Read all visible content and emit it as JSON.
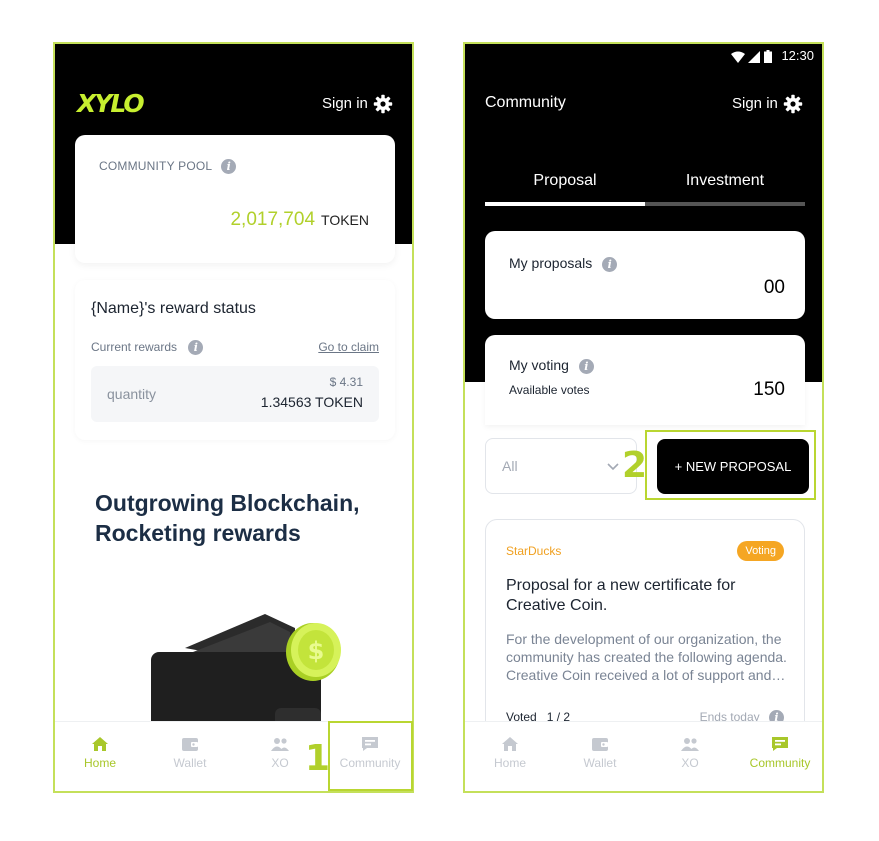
{
  "left": {
    "logo": "XYLO",
    "sign_in": "Sign in",
    "pool": {
      "label": "COMMUNITY POOL",
      "value": "2,017,704",
      "unit": "TOKEN"
    },
    "reward": {
      "title": "{Name}'s reward status",
      "current_label": "Current rewards",
      "claim_link": "Go to claim",
      "quantity_label": "quantity",
      "usd": "$ 4.31",
      "token": "1.34563 TOKEN"
    },
    "hero_line1": "Outgrowing Blockchain,",
    "hero_line2": "Rocketing rewards",
    "tabs": [
      "Home",
      "Wallet",
      "XO",
      "Community"
    ],
    "step": "1"
  },
  "right": {
    "status_time": "12:30",
    "title": "Community",
    "sign_in": "Sign in",
    "segments": [
      "Proposal",
      "Investment"
    ],
    "my_proposals": {
      "label": "My proposals",
      "value": "00"
    },
    "my_voting": {
      "label": "My voting",
      "sub": "Available votes",
      "value": "150"
    },
    "filter": "All",
    "new_button": "+ NEW PROPOSAL",
    "step": "2",
    "proposal": {
      "org": "StarDucks",
      "badge": "Voting",
      "title": "Proposal for a new certificate for Creative Coin.",
      "desc": "For the development of our organization, the community has created the following agenda. Creative Coin received a lot of support and…",
      "voted": "Voted   1 / 2",
      "ends": "Ends today"
    },
    "tabs": [
      "Home",
      "Wallet",
      "XO",
      "Community"
    ]
  },
  "colors": {
    "accent": "#b1d02b",
    "badge": "#f5a623",
    "highlight": "#b9d631"
  }
}
